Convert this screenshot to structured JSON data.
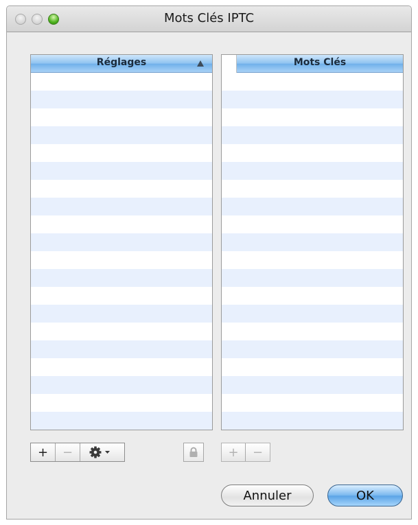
{
  "window": {
    "title": "Mots Clés IPTC"
  },
  "left_table": {
    "header": "Réglages",
    "sort_icon": "triangle-up-icon",
    "rows": []
  },
  "right_table": {
    "header": "Mots Clés",
    "rows": []
  },
  "left_toolbar": {
    "add_label": "+",
    "remove_label": "−",
    "gear_icon": "gear-icon",
    "dropdown_icon": "chevron-down-icon"
  },
  "lock_icon": "lock-icon",
  "right_toolbar": {
    "add_label": "+",
    "remove_label": "−"
  },
  "buttons": {
    "cancel_label": "Annuler",
    "ok_label": "OK"
  },
  "colors": {
    "accent": "#6fb0ea",
    "row_stripe": "#e8f0fd"
  }
}
